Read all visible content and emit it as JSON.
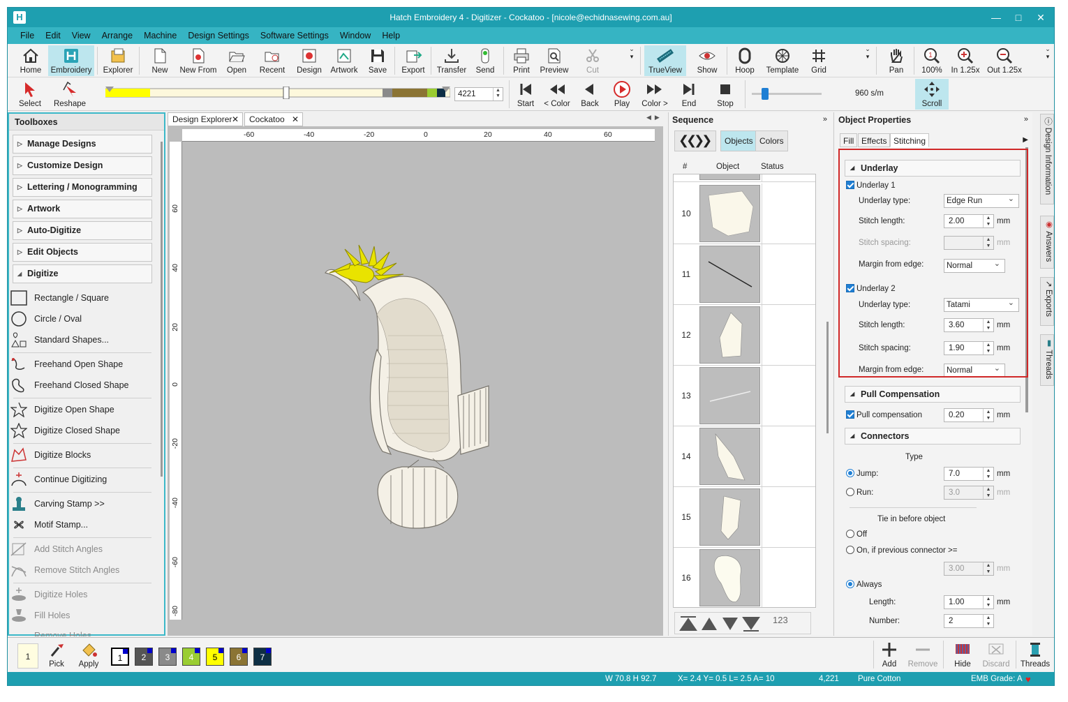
{
  "window": {
    "title": "Hatch Embroidery 4 - Digitizer - Cockatoo - [nicole@echidnasewing.com.au]"
  },
  "menu": [
    "File",
    "Edit",
    "View",
    "Arrange",
    "Machine",
    "Design Settings",
    "Software Settings",
    "Window",
    "Help"
  ],
  "toolbar": {
    "home": "Home",
    "embroidery": "Embroidery",
    "explorer": "Explorer",
    "new": "New",
    "new_from": "New From",
    "open": "Open",
    "recent": "Recent",
    "design": "Design",
    "artwork": "Artwork",
    "save": "Save",
    "export": "Export",
    "transfer": "Transfer",
    "send": "Send",
    "print": "Print",
    "preview": "Preview",
    "cut": "Cut",
    "trueview": "TrueView",
    "show": "Show",
    "hoop": "Hoop",
    "template": "Template",
    "grid": "Grid",
    "pan": "Pan",
    "zoom100": "100%",
    "zoom_in": "In 1.25x",
    "zoom_out": "Out 1.25x"
  },
  "toolbar2": {
    "select": "Select",
    "reshape": "Reshape",
    "stitch_count": "4221",
    "start": "Start",
    "color_back": "< Color",
    "back": "Back",
    "play": "Play",
    "color_fwd": "Color >",
    "end": "End",
    "stop": "Stop",
    "speed": "960 s/m",
    "scroll": "Scroll"
  },
  "toolboxes": {
    "title": "Toolboxes",
    "groups": [
      "Manage Designs",
      "Customize Design",
      "Lettering / Monogramming",
      "Artwork",
      "Auto-Digitize",
      "Edit Objects",
      "Digitize"
    ],
    "tools": [
      "Rectangle / Square",
      "Circle / Oval",
      "Standard Shapes...",
      "Freehand Open Shape",
      "Freehand Closed Shape",
      "Digitize Open Shape",
      "Digitize Closed Shape",
      "Digitize Blocks",
      "Continue Digitizing",
      "Carving Stamp >>",
      "Motif Stamp...",
      "Add Stitch Angles",
      "Remove Stitch Angles",
      "Digitize Holes",
      "Fill Holes",
      "Remove Holes"
    ]
  },
  "doc_tabs": [
    "Design Explorer",
    "Cockatoo"
  ],
  "ruler": {
    "top": [
      "-60",
      "-40",
      "-20",
      "0",
      "20",
      "40",
      "60"
    ],
    "left": [
      "60",
      "40",
      "20",
      "0",
      "-20",
      "-40",
      "-60",
      "-80"
    ]
  },
  "sequence": {
    "title": "Sequence",
    "objects_btn": "Objects",
    "colors_btn": "Colors",
    "columns": [
      "#",
      "Object",
      "Status"
    ],
    "rows": [
      "10",
      "11",
      "12",
      "13",
      "14",
      "15",
      "16"
    ],
    "sort_label": "123"
  },
  "properties": {
    "title": "Object Properties",
    "tabs": [
      "Fill",
      "Effects",
      "Stitching"
    ],
    "underlay": {
      "section": "Underlay",
      "u1_label": "Underlay 1",
      "u1_type_label": "Underlay type:",
      "u1_type": "Edge Run",
      "u1_len_label": "Stitch length:",
      "u1_len": "2.00",
      "u1_spacing_label": "Stitch spacing:",
      "u1_margin_label": "Margin from edge:",
      "u1_margin": "Normal",
      "u2_label": "Underlay 2",
      "u2_type_label": "Underlay type:",
      "u2_type": "Tatami",
      "u2_len_label": "Stitch length:",
      "u2_len": "3.60",
      "u2_spacing_label": "Stitch spacing:",
      "u2_spacing": "1.90",
      "u2_margin_label": "Margin from edge:",
      "u2_margin": "Normal"
    },
    "pull": {
      "section": "Pull Compensation",
      "label": "Pull compensation",
      "value": "0.20"
    },
    "connectors": {
      "section": "Connectors",
      "type_label": "Type",
      "jump_label": "Jump:",
      "jump": "7.0",
      "run_label": "Run:",
      "run": "3.0",
      "tie_label": "Tie in before object",
      "off_label": "Off",
      "on_if_label": "On, if previous connector >=",
      "on_if_value": "3.00",
      "always_label": "Always",
      "length_label": "Length:",
      "length": "1.00",
      "number_label": "Number:",
      "number": "2"
    },
    "unit": "mm"
  },
  "side_tabs": [
    "Design Information",
    "Answers",
    "Exports",
    "Threads"
  ],
  "bottom": {
    "current": "1",
    "pick": "Pick",
    "apply": "Apply",
    "swatches": [
      {
        "n": "1",
        "color": "#ffffff"
      },
      {
        "n": "2",
        "color": "#555555"
      },
      {
        "n": "3",
        "color": "#8a8a8a"
      },
      {
        "n": "4",
        "color": "#9acd32"
      },
      {
        "n": "5",
        "color": "#ffff00"
      },
      {
        "n": "6",
        "color": "#8b7434"
      },
      {
        "n": "7",
        "color": "#0e2f45"
      }
    ],
    "add": "Add",
    "remove": "Remove",
    "hide": "Hide",
    "discard": "Discard",
    "threads": "Threads"
  },
  "status": {
    "size": "W  70.8 H  92.7",
    "coords": "X=  2.4 Y=  0.5 L=  2.5 A=  10",
    "count": "4,221",
    "thread": "Pure Cotton",
    "grade": "EMB Grade: A"
  }
}
